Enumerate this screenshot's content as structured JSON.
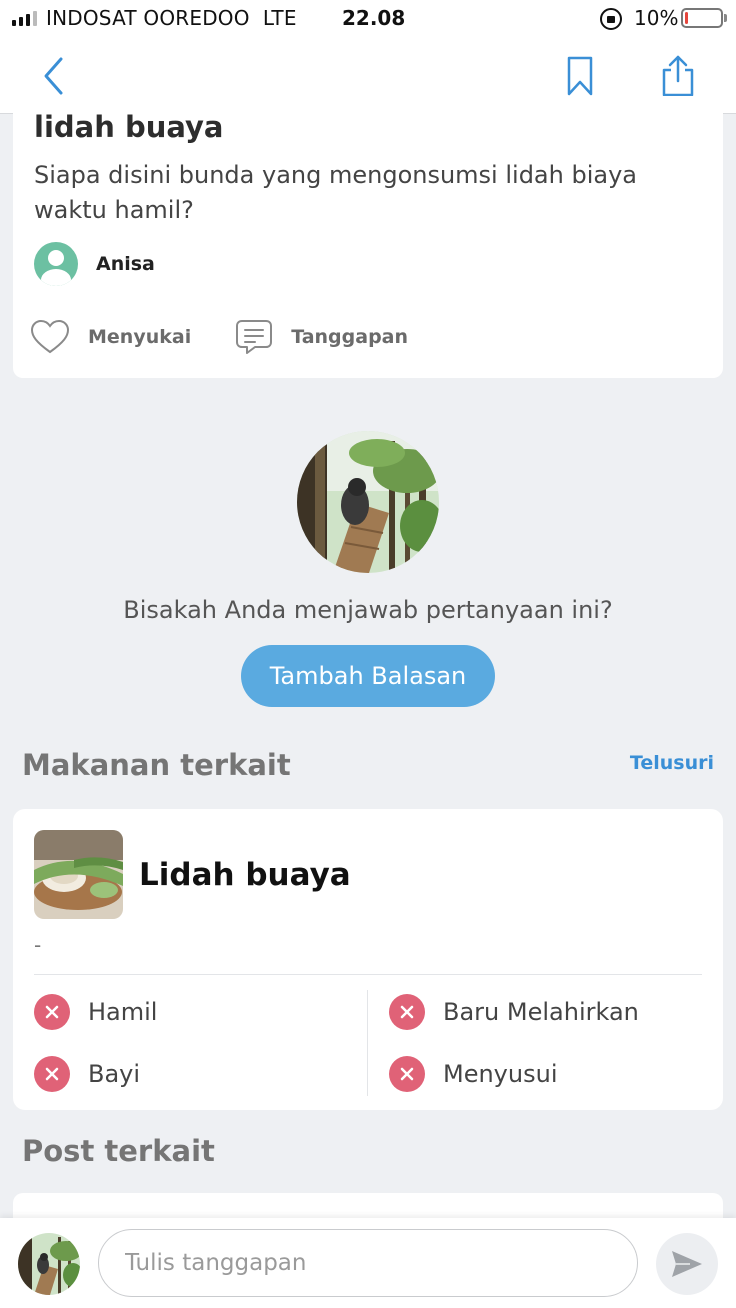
{
  "status_bar": {
    "carrier": "INDOSAT OOREDOO",
    "network": "LTE",
    "time": "22.08",
    "battery_percent": "10%",
    "battery_level": 0.1,
    "battery_color": "#e5463d"
  },
  "nav": {
    "back_icon": "chevron-left-icon",
    "bookmark_icon": "bookmark-icon",
    "share_icon": "share-icon",
    "accent_color": "#3a8fd6"
  },
  "question": {
    "title": "lidah buaya",
    "body": "Siapa disini bunda yang mengonsumsi lidah biaya waktu hamil?",
    "author": "Anisa",
    "like_label": "Menyukai",
    "comment_label": "Tanggapan"
  },
  "answer_prompt": {
    "text": "Bisakah Anda menjawab pertanyaan ini?",
    "button_label": "Tambah Balasan",
    "button_color": "#5aaae0"
  },
  "related_food": {
    "section_title": "Makanan terkait",
    "browse_label": "Telusuri",
    "food": {
      "name": "Lidah buaya",
      "description": "-",
      "statuses": [
        {
          "label": "Hamil",
          "safe": false
        },
        {
          "label": "Baru Melahirkan",
          "safe": false
        },
        {
          "label": "Bayi",
          "safe": false
        },
        {
          "label": "Menyusui",
          "safe": false
        }
      ],
      "unsafe_color": "#e06277"
    }
  },
  "related_posts": {
    "section_title": "Post terkait"
  },
  "comment_bar": {
    "placeholder": "Tulis tanggapan",
    "send_icon": "send-icon"
  }
}
